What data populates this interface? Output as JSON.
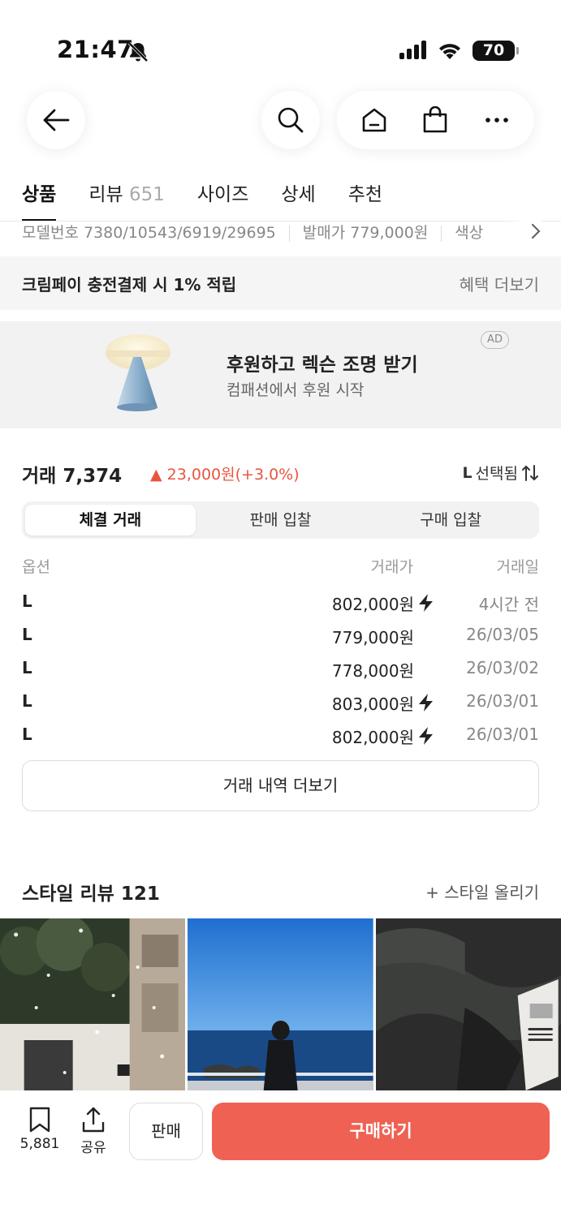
{
  "status_bar": {
    "time": "21:47",
    "battery": "70"
  },
  "tabs": [
    {
      "label": "상품",
      "count": ""
    },
    {
      "label": "리뷰",
      "count": "651"
    },
    {
      "label": "사이즈",
      "count": ""
    },
    {
      "label": "상세",
      "count": ""
    },
    {
      "label": "추천",
      "count": ""
    }
  ],
  "info_row": {
    "model": "모델번호 7380/10543/6919/29695",
    "release_price": "발매가 779,000원",
    "color": "색상"
  },
  "benefit": {
    "text": "크림페이 충전결제 시 1% 적립",
    "more": "혜택 더보기"
  },
  "ad": {
    "title": "후원하고 렉슨 조명 받기",
    "subtitle": "컴패션에서 후원 시작",
    "badge": "AD"
  },
  "trade": {
    "label": "거래 7,374",
    "change": "▲ 23,000원(+3.0%)",
    "selected_size": "L",
    "selected_suffix": "선택됨",
    "segments": [
      "체결 거래",
      "판매 입찰",
      "구매 입찰"
    ],
    "columns": {
      "option": "옵션",
      "price": "거래가",
      "date": "거래일"
    },
    "rows": [
      {
        "option": "L",
        "price": "802,000원",
        "date": "4시간 전",
        "flash": true
      },
      {
        "option": "L",
        "price": "779,000원",
        "date": "26/03/05",
        "flash": false
      },
      {
        "option": "L",
        "price": "778,000원",
        "date": "26/03/02",
        "flash": false
      },
      {
        "option": "L",
        "price": "803,000원",
        "date": "26/03/01",
        "flash": true
      },
      {
        "option": "L",
        "price": "802,000원",
        "date": "26/03/01",
        "flash": true
      }
    ],
    "more": "거래 내역 더보기"
  },
  "style_review": {
    "title": "스타일 리뷰 121",
    "add": "+ 스타일 올리기"
  },
  "bottom": {
    "bookmark_count": "5,881",
    "share": "공유",
    "sell": "판매",
    "buy": "구매하기"
  },
  "colors": {
    "accent": "#ef6253",
    "up": "#e8553f"
  }
}
